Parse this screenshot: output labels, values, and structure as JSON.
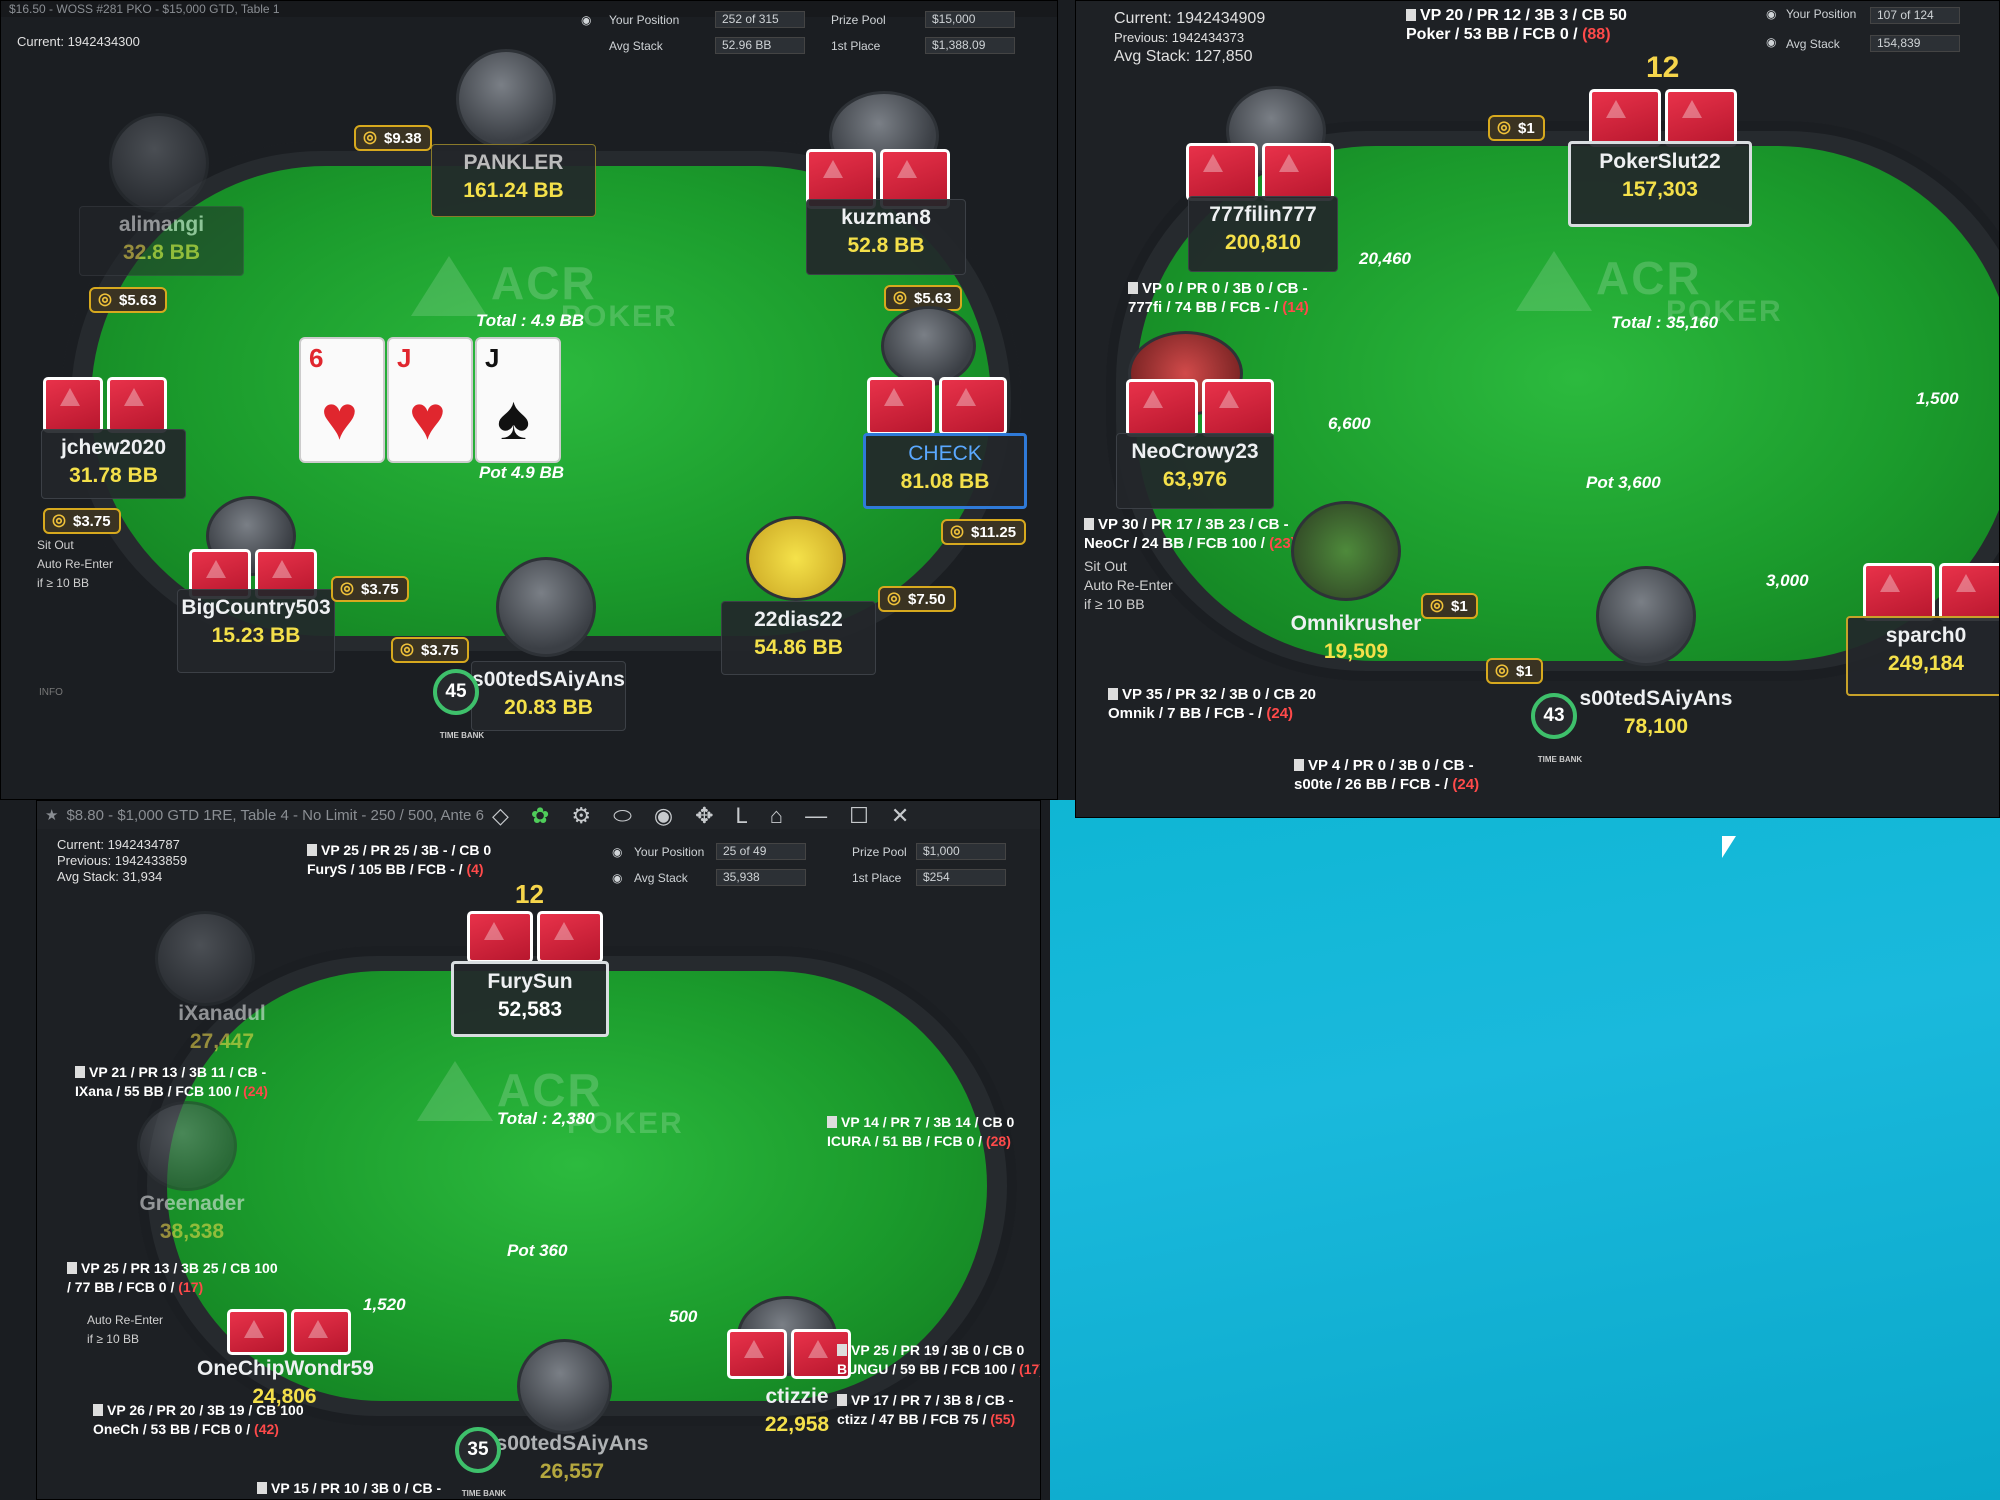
{
  "w1": {
    "title": "$16.50 - WOSS #281 PKO - $15,000 GTD, Table 1",
    "current": "Current: 1942434300",
    "your_position_label": "Your Position",
    "your_position": "252 of 315",
    "avg_stack_label": "Avg Stack",
    "avg_stack": "52.96 BB",
    "prize_pool_label": "Prize Pool",
    "prize_pool": "$15,000",
    "first_place_label": "1st Place",
    "first_place": "$1,388.09",
    "total": "Total : 4.9 BB",
    "pot": "Pot 4.9 BB",
    "board": [
      {
        "rank": "6",
        "suit": "♥"
      },
      {
        "rank": "J",
        "suit": "♥"
      },
      {
        "rank": "J",
        "suit": "♠"
      }
    ],
    "players": [
      {
        "name": "PANKLER",
        "stack": "161.24 BB"
      },
      {
        "name": "alimangi",
        "stack": "32.8 BB"
      },
      {
        "name": "kuzman8",
        "stack": "52.8 BB"
      },
      {
        "name": "jchew2020",
        "stack": "31.78 BB"
      },
      {
        "name": "CHECK",
        "stack": "81.08 BB"
      },
      {
        "name": "BigCountry503",
        "stack": "15.23 BB"
      },
      {
        "name": "22dias22",
        "stack": "54.86 BB"
      },
      {
        "name": "s00tedSAiyAns",
        "stack": "20.83 BB"
      }
    ],
    "bounties": [
      "$9.38",
      "$5.63",
      "$5.63",
      "$3.75",
      "$3.75",
      "$3.75",
      "$11.25",
      "$7.50"
    ],
    "timer": "45",
    "time_bank": "TIME BANK",
    "sit_out": "Sit Out",
    "auto_reenter": "Auto Re-Enter",
    "if_ge": "if ≥",
    "if_val": "10",
    "bb": "BB",
    "info": "INFO"
  },
  "w2": {
    "current": "Current: 1942434909",
    "previous": "Previous: 1942434373",
    "avg": "Avg Stack: 127,850",
    "your_position_label": "Your Position",
    "your_position": "107 of 124",
    "avg_stack_label": "Avg Stack",
    "avg_stack": "154,839",
    "top_stats": {
      "line1": "VP 20 / PR 12 / 3B 3 / CB 50",
      "line2": "Poker / 53 BB / FCB 0 /",
      "red": "(88)"
    },
    "total": "Total : 35,160",
    "pot": "Pot 3,600",
    "players": [
      {
        "name": "777filin777",
        "stack": "200,810"
      },
      {
        "name": "PokerSlut22",
        "stack": "157,303"
      },
      {
        "name": "NeoCrowy23",
        "stack": "63,976"
      },
      {
        "name": "Omnikrusher",
        "stack": "19,509"
      },
      {
        "name": "s00tedSAiyAns",
        "stack": "78,100"
      },
      {
        "name": "sparch0",
        "stack": "249,184"
      }
    ],
    "bets": [
      "20,460",
      "6,600",
      "1,500",
      "3,000"
    ],
    "badges": [
      "$1",
      "$1",
      "$1"
    ],
    "stats": [
      {
        "line1": "VP 0 / PR 0 / 3B 0 / CB -",
        "line2": "777fi / 74 BB / FCB - /",
        "red": "(14)"
      },
      {
        "line1": "VP 30 / PR 17 / 3B 23 / CB -",
        "line2": "NeoCr / 24 BB / FCB 100 /",
        "red": "(23)"
      },
      {
        "line1": "VP 35 / PR 32 / 3B 0 / CB 20",
        "line2": "Omnik / 7 BB / FCB - /",
        "red": "(24)"
      },
      {
        "line1": "VP 4 / PR 0 / 3B 0 / CB -",
        "line2": "s00te / 26 BB / FCB - /",
        "red": "(24)"
      }
    ],
    "timer": "43",
    "time_bank": "TIME BANK",
    "dealer_num": "12",
    "sit_out": "Sit Out",
    "auto_reenter": "Auto Re-Enter",
    "if_ge": "if ≥",
    "if_val": "10",
    "bb": "BB"
  },
  "w3": {
    "title": "$8.80 - $1,000 GTD 1RE, Table 4 - No Limit - 250 / 500, Ante 6",
    "current": "Current: 1942434787",
    "previous": "Previous: 1942433859",
    "avg": "Avg Stack: 31,934",
    "your_position_label": "Your Position",
    "your_position": "25 of 49",
    "avg_stack_label": "Avg Stack",
    "avg_stack": "35,938",
    "prize_pool_label": "Prize Pool",
    "prize_pool": "$1,000",
    "first_place_label": "1st Place",
    "first_place": "$254",
    "top_stats": {
      "line1": "VP 25 / PR 25 / 3B - / CB 0",
      "line2": "FuryS / 105 BB / FCB - /",
      "red": "(4)"
    },
    "total": "Total : 2,380",
    "pot": "Pot 360",
    "players": [
      {
        "name": "FurySun",
        "stack": "52,583"
      },
      {
        "name": "iXanadul",
        "stack": "27,447"
      },
      {
        "name": "Greenader",
        "stack": "38,338"
      },
      {
        "name": "OneChipWondr59",
        "stack": "24,806"
      },
      {
        "name": "s00tedSAiyAns",
        "stack": "26,557"
      },
      {
        "name": "ctizzie",
        "stack": "22,958"
      }
    ],
    "bets": [
      "1,520",
      "500"
    ],
    "stats": [
      {
        "line1": "VP 21 / PR 13 / 3B 11 / CB -",
        "line2": "IXana / 55 BB / FCB 100 /",
        "red": "(24)"
      },
      {
        "line1": "VP 14 / PR 7 / 3B 14 / CB 0",
        "line2": "ICURA / 51 BB / FCB 0 /",
        "red": "(28)"
      },
      {
        "line1": "VP 25 / PR 13 / 3B 25 / CB 100",
        "line2": "/ 77 BB / FCB 0 /",
        "red": "(17)"
      },
      {
        "line1": "VP 25 / PR 19 / 3B 0 / CB 0",
        "line2": "BUNGU / 59 BB / FCB 100 /",
        "red": "(17)"
      },
      {
        "line1": "VP 17 / PR 7 / 3B 8 / CB -",
        "line2": "ctizz / 47 BB / FCB 75 /",
        "red": "(55)"
      },
      {
        "line1": "VP 26 / PR 20 / 3B 19 / CB 100",
        "line2": "OneCh / 53 BB / FCB 0 /",
        "red": "(42)"
      },
      {
        "line1": "VP 15 / PR 10 / 3B 0 / CB -",
        "line2": "",
        "red": ""
      }
    ],
    "timer": "35",
    "time_bank": "TIME BANK",
    "dealer_num": "12",
    "auto_reenter": "Auto Re-Enter",
    "if_ge": "if ≥",
    "if_val": "10",
    "bb": "BB"
  },
  "logo": {
    "main": "ACR",
    "sub": "POKER"
  }
}
